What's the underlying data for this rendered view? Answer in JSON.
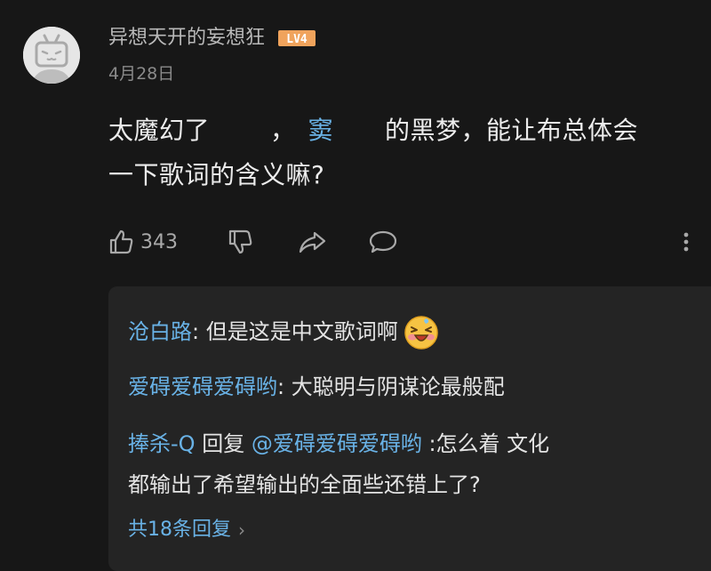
{
  "comment": {
    "username": "异想天开的妄想狂",
    "level_badge": "LV4",
    "date": "4月28日",
    "body": {
      "part1": "太魔幻了",
      "part2": "，",
      "highlight": "窦",
      "part3": "的黑梦，能让布总体会",
      "line2": "一下歌词的含义嘛?"
    },
    "actions": {
      "like_count": "343"
    }
  },
  "replies": [
    {
      "name": "沧白路",
      "sep": ": ",
      "text": "但是这是中文歌词啊"
    },
    {
      "name": "爱碍爱碍爱碍哟",
      "sep": ": ",
      "text": "大聪明与阴谋论最般配"
    },
    {
      "name": "捧杀-Q",
      "verb": " 回复 ",
      "target": "@爱碍爱碍爱碍哟",
      "text": " :怎么着 文化",
      "text_line2": "都输出了希望输出的全面些还错上了?"
    }
  ],
  "more_replies": {
    "label": "共18条回复",
    "chevron": "›"
  },
  "colors": {
    "background": "#171717",
    "reply_box": "#242424",
    "link_blue": "#69b2e6",
    "level_badge": "#f0a35c"
  },
  "icons": {
    "like": "thumbs-up-icon",
    "dislike": "thumbs-down-icon",
    "share": "share-icon",
    "reply": "comment-icon",
    "more": "vertical-dots-icon"
  }
}
